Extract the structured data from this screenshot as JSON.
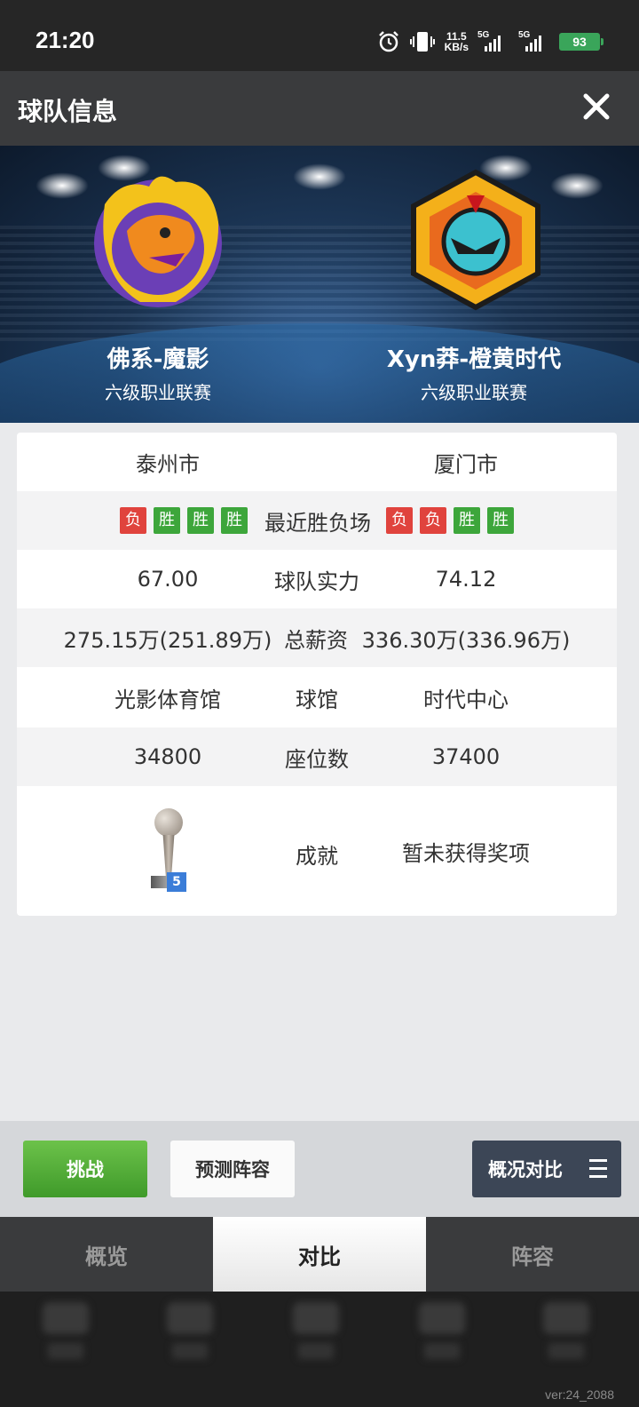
{
  "status_bar": {
    "time": "21:20",
    "net_speed_value": "11.5",
    "net_speed_unit": "KB/s",
    "signal1_label": "5G",
    "signal2_label": "5G",
    "battery": "93"
  },
  "header": {
    "title": "球队信息"
  },
  "teams": {
    "home": {
      "name": "佛系-魔影",
      "league": "六级职业联赛"
    },
    "away": {
      "name": "Xyn莽-橙黄时代",
      "league": "六级职业联赛"
    }
  },
  "comparison": {
    "city": {
      "home": "泰州市",
      "away": "厦门市"
    },
    "recent": {
      "label": "最近胜负场",
      "home": [
        "负",
        "胜",
        "胜",
        "胜"
      ],
      "away": [
        "负",
        "负",
        "胜",
        "胜"
      ]
    },
    "strength": {
      "label": "球队实力",
      "home": "67.00",
      "away": "74.12"
    },
    "salary": {
      "label": "总薪资",
      "home": "275.15万(251.89万)",
      "away": "336.30万(336.96万)"
    },
    "arena": {
      "label": "球馆",
      "home": "光影体育馆",
      "away": "时代中心"
    },
    "seats": {
      "label": "座位数",
      "home": "34800",
      "away": "37400"
    },
    "achievement": {
      "label": "成就",
      "home_trophy_count": "5",
      "away": "暂未获得奖项"
    }
  },
  "actions": {
    "challenge": "挑战",
    "predict_lineup": "预测阵容",
    "overview_compare": "概况对比"
  },
  "tabs": [
    {
      "label": "概览",
      "active": false
    },
    {
      "label": "对比",
      "active": true
    },
    {
      "label": "阵容",
      "active": false
    }
  ],
  "version": "ver:24_2088",
  "colors": {
    "win": "#3da63b",
    "loss": "#e0433d",
    "challenge_button": "#52ad36",
    "overview_button": "#3c4656"
  }
}
